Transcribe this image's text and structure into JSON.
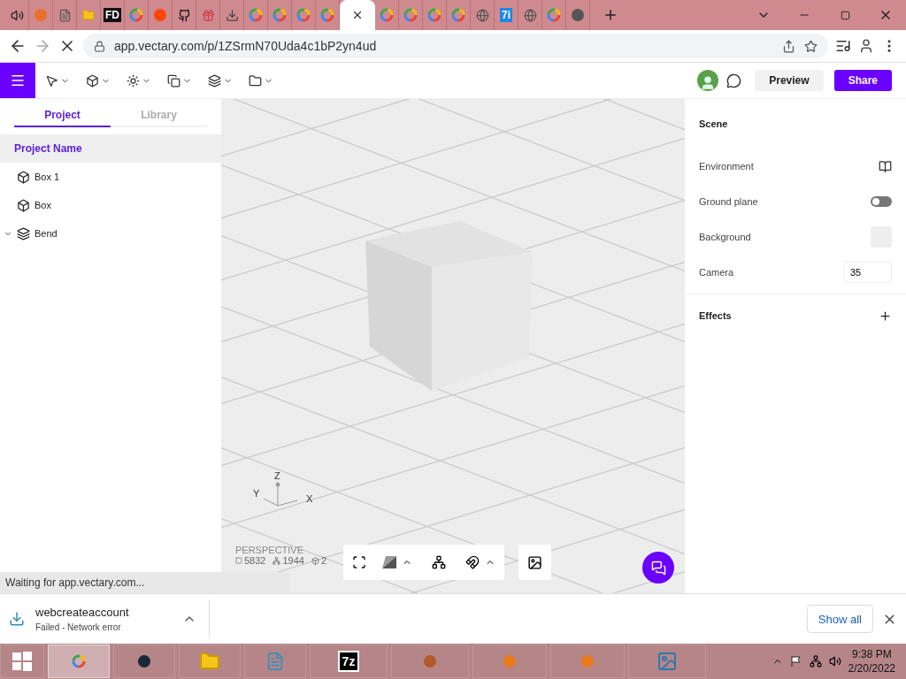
{
  "browser": {
    "tabs": [
      {
        "kind": "speaker",
        "selected": false
      },
      {
        "kind": "app",
        "selected": false
      },
      {
        "kind": "document",
        "selected": false
      },
      {
        "kind": "folder",
        "selected": false
      },
      {
        "kind": "text",
        "label": "FD",
        "selected": false
      },
      {
        "kind": "google",
        "selected": false
      },
      {
        "kind": "reddit",
        "selected": false
      },
      {
        "kind": "github",
        "selected": false
      },
      {
        "kind": "gift",
        "selected": false
      },
      {
        "kind": "download",
        "selected": false
      },
      {
        "kind": "google",
        "selected": false
      },
      {
        "kind": "google",
        "selected": false
      },
      {
        "kind": "google",
        "selected": false
      },
      {
        "kind": "google",
        "selected": false
      },
      {
        "kind": "close",
        "selected": true
      },
      {
        "kind": "google",
        "selected": false
      },
      {
        "kind": "google",
        "selected": false
      },
      {
        "kind": "google",
        "selected": false
      },
      {
        "kind": "google",
        "selected": false
      },
      {
        "kind": "globe",
        "selected": false
      },
      {
        "kind": "text",
        "label": "7i",
        "selected": false
      },
      {
        "kind": "globe",
        "selected": false
      },
      {
        "kind": "google",
        "selected": false
      },
      {
        "kind": "chrome",
        "selected": false
      }
    ],
    "url": "app.vectary.com/p/1ZSrmN70Uda4c1bP2yn4ud",
    "status": "Waiting for app.vectary.com..."
  },
  "toolbar": {
    "preview": "Preview",
    "share": "Share"
  },
  "left_panel": {
    "tabs": [
      {
        "label": "Project",
        "selected": true
      },
      {
        "label": "Library",
        "selected": false
      }
    ],
    "project_name": "Project Name",
    "items": [
      {
        "kind": "box",
        "name": "Box 1"
      },
      {
        "kind": "box",
        "name": "Box"
      },
      {
        "kind": "bend",
        "name": "Bend",
        "expanded": true
      }
    ]
  },
  "viewport": {
    "axes": {
      "z": "Z",
      "y": "Y",
      "x": "X"
    },
    "view": "PERSPECTIVE",
    "stats": [
      "5832",
      "1944",
      "2"
    ]
  },
  "right_panel": {
    "scene_title": "Scene",
    "rows": [
      {
        "kind": "icon",
        "label": "Environment"
      },
      {
        "kind": "toggle",
        "label": "Ground plane",
        "on": false
      },
      {
        "kind": "swatch",
        "label": "Background",
        "color": "#eeeeee"
      },
      {
        "kind": "input",
        "label": "Camera",
        "value": "35"
      }
    ],
    "effects_title": "Effects"
  },
  "download_bar": {
    "file": "webcreateaccount",
    "status": "Failed - Network error",
    "show_all": "Show all"
  },
  "taskbar": {
    "apps": [
      {
        "kind": "chrome",
        "selected": true
      },
      {
        "kind": "steam",
        "selected": false
      },
      {
        "kind": "folder",
        "selected": false
      },
      {
        "kind": "notepad",
        "selected": false
      },
      {
        "kind": "text",
        "label": "7z",
        "selected": false
      },
      {
        "kind": "media",
        "selected": false
      },
      {
        "kind": "arrow",
        "selected": false
      },
      {
        "kind": "arrow",
        "selected": false
      },
      {
        "kind": "photos",
        "selected": false
      }
    ],
    "time": "9:38 PM",
    "date": "2/20/2022"
  }
}
